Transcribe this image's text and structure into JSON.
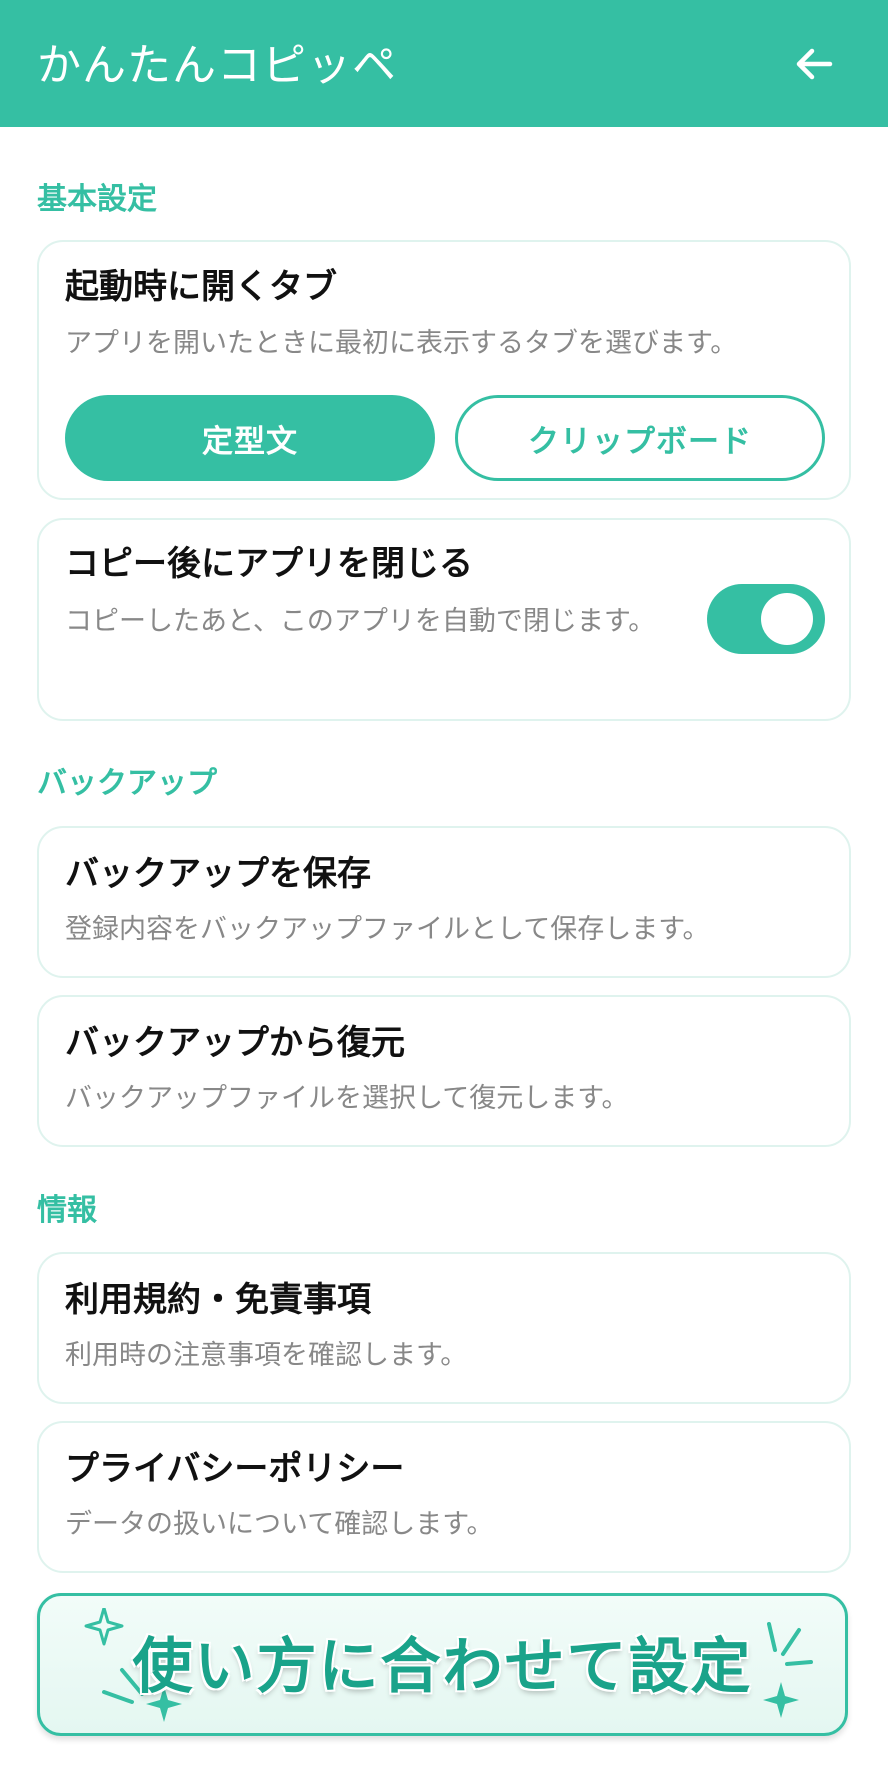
{
  "app_bar": {
    "title": "かんたんコピッペ",
    "back_icon": "arrow-left-icon"
  },
  "sections": {
    "basic": {
      "title": "基本設定",
      "startup_tab": {
        "title": "起動時に開くタブ",
        "description": "アプリを開いたときに最初に表示するタブを選びます。",
        "options": [
          "定型文",
          "クリップボード"
        ],
        "selected": "定型文"
      },
      "close_after_copy": {
        "title": "コピー後にアプリを閉じる",
        "description": "コピーしたあと、このアプリを自動で閉じます。",
        "enabled": true
      }
    },
    "backup": {
      "title": "バックアップ",
      "save": {
        "title": "バックアップを保存",
        "description": "登録内容をバックアップファイルとして保存します。"
      },
      "restore": {
        "title": "バックアップから復元",
        "description": "バックアップファイルを選択して復元します。"
      }
    },
    "info": {
      "title": "情報",
      "terms": {
        "title": "利用規約・免責事項",
        "description": "利用時の注意事項を確認します。"
      },
      "privacy": {
        "title": "プライバシーポリシー",
        "description": "データの扱いについて確認します。"
      }
    }
  },
  "banner": {
    "text": "使い方に合わせて設定"
  },
  "colors": {
    "accent": "#35bfa3",
    "banner_text": "#1aa38a",
    "card_border": "#dff3ee"
  }
}
